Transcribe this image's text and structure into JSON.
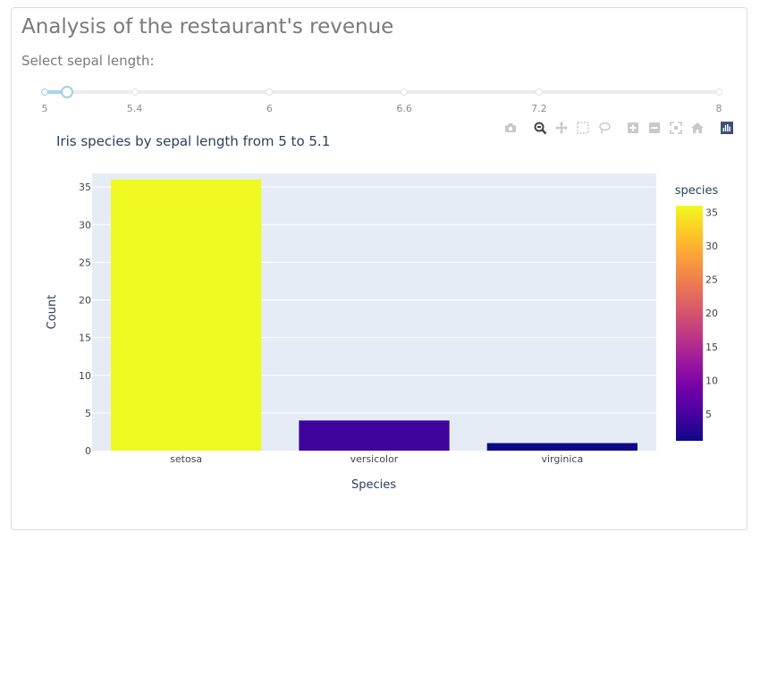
{
  "page": {
    "title": "Analysis of the restaurant's revenue",
    "slider_label": "Select sepal length:"
  },
  "slider": {
    "min": 5,
    "max": 8,
    "value": [
      5,
      5.1
    ],
    "marks": [
      "5",
      "5.4",
      "6",
      "6.6",
      "7.2",
      "8"
    ]
  },
  "modebar": [
    "camera-icon",
    "zoom-icon",
    "pan-icon",
    "box-select-icon",
    "lasso-select-icon",
    "zoom-in-icon",
    "zoom-out-icon",
    "autoscale-icon",
    "reset-axes-icon",
    "plotly-logo-icon"
  ],
  "chart_data": {
    "type": "bar",
    "title": "Iris species by sepal length from 5 to 5.1",
    "xlabel": "Species",
    "ylabel": "Count",
    "categories": [
      "setosa",
      "versicolor",
      "virginica"
    ],
    "values": [
      36,
      4,
      1
    ],
    "ylim": [
      0,
      36.8
    ],
    "yticks": [
      0,
      5,
      10,
      15,
      20,
      25,
      30,
      35
    ],
    "grid": true,
    "colorbar": {
      "title": "species",
      "ticks": [
        5,
        10,
        15,
        20,
        25,
        30,
        35
      ],
      "range": [
        1,
        36
      ],
      "colorscale": [
        "#0d0887",
        "#46039f",
        "#7201a8",
        "#9c179e",
        "#bd3786",
        "#d8576b",
        "#ed7953",
        "#fb9f3a",
        "#fdca26",
        "#f0f921"
      ]
    },
    "colors": {
      "plot_bg": "#e5ecf6",
      "grid": "#ffffff",
      "font": "#2a3f5f",
      "bars": [
        "#f0f921",
        "#3e049c",
        "#0d0887"
      ]
    }
  }
}
